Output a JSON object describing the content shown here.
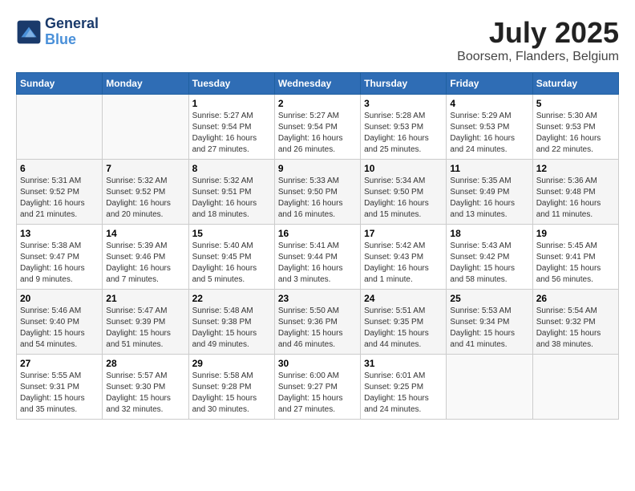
{
  "logo": {
    "text_general": "General",
    "text_blue": "Blue"
  },
  "title": "July 2025",
  "subtitle": "Boorsem, Flanders, Belgium",
  "days_of_week": [
    "Sunday",
    "Monday",
    "Tuesday",
    "Wednesday",
    "Thursday",
    "Friday",
    "Saturday"
  ],
  "weeks": [
    [
      {
        "day": "",
        "info": ""
      },
      {
        "day": "",
        "info": ""
      },
      {
        "day": "1",
        "info": "Sunrise: 5:27 AM\nSunset: 9:54 PM\nDaylight: 16 hours and 27 minutes."
      },
      {
        "day": "2",
        "info": "Sunrise: 5:27 AM\nSunset: 9:54 PM\nDaylight: 16 hours and 26 minutes."
      },
      {
        "day": "3",
        "info": "Sunrise: 5:28 AM\nSunset: 9:53 PM\nDaylight: 16 hours and 25 minutes."
      },
      {
        "day": "4",
        "info": "Sunrise: 5:29 AM\nSunset: 9:53 PM\nDaylight: 16 hours and 24 minutes."
      },
      {
        "day": "5",
        "info": "Sunrise: 5:30 AM\nSunset: 9:53 PM\nDaylight: 16 hours and 22 minutes."
      }
    ],
    [
      {
        "day": "6",
        "info": "Sunrise: 5:31 AM\nSunset: 9:52 PM\nDaylight: 16 hours and 21 minutes."
      },
      {
        "day": "7",
        "info": "Sunrise: 5:32 AM\nSunset: 9:52 PM\nDaylight: 16 hours and 20 minutes."
      },
      {
        "day": "8",
        "info": "Sunrise: 5:32 AM\nSunset: 9:51 PM\nDaylight: 16 hours and 18 minutes."
      },
      {
        "day": "9",
        "info": "Sunrise: 5:33 AM\nSunset: 9:50 PM\nDaylight: 16 hours and 16 minutes."
      },
      {
        "day": "10",
        "info": "Sunrise: 5:34 AM\nSunset: 9:50 PM\nDaylight: 16 hours and 15 minutes."
      },
      {
        "day": "11",
        "info": "Sunrise: 5:35 AM\nSunset: 9:49 PM\nDaylight: 16 hours and 13 minutes."
      },
      {
        "day": "12",
        "info": "Sunrise: 5:36 AM\nSunset: 9:48 PM\nDaylight: 16 hours and 11 minutes."
      }
    ],
    [
      {
        "day": "13",
        "info": "Sunrise: 5:38 AM\nSunset: 9:47 PM\nDaylight: 16 hours and 9 minutes."
      },
      {
        "day": "14",
        "info": "Sunrise: 5:39 AM\nSunset: 9:46 PM\nDaylight: 16 hours and 7 minutes."
      },
      {
        "day": "15",
        "info": "Sunrise: 5:40 AM\nSunset: 9:45 PM\nDaylight: 16 hours and 5 minutes."
      },
      {
        "day": "16",
        "info": "Sunrise: 5:41 AM\nSunset: 9:44 PM\nDaylight: 16 hours and 3 minutes."
      },
      {
        "day": "17",
        "info": "Sunrise: 5:42 AM\nSunset: 9:43 PM\nDaylight: 16 hours and 1 minute."
      },
      {
        "day": "18",
        "info": "Sunrise: 5:43 AM\nSunset: 9:42 PM\nDaylight: 15 hours and 58 minutes."
      },
      {
        "day": "19",
        "info": "Sunrise: 5:45 AM\nSunset: 9:41 PM\nDaylight: 15 hours and 56 minutes."
      }
    ],
    [
      {
        "day": "20",
        "info": "Sunrise: 5:46 AM\nSunset: 9:40 PM\nDaylight: 15 hours and 54 minutes."
      },
      {
        "day": "21",
        "info": "Sunrise: 5:47 AM\nSunset: 9:39 PM\nDaylight: 15 hours and 51 minutes."
      },
      {
        "day": "22",
        "info": "Sunrise: 5:48 AM\nSunset: 9:38 PM\nDaylight: 15 hours and 49 minutes."
      },
      {
        "day": "23",
        "info": "Sunrise: 5:50 AM\nSunset: 9:36 PM\nDaylight: 15 hours and 46 minutes."
      },
      {
        "day": "24",
        "info": "Sunrise: 5:51 AM\nSunset: 9:35 PM\nDaylight: 15 hours and 44 minutes."
      },
      {
        "day": "25",
        "info": "Sunrise: 5:53 AM\nSunset: 9:34 PM\nDaylight: 15 hours and 41 minutes."
      },
      {
        "day": "26",
        "info": "Sunrise: 5:54 AM\nSunset: 9:32 PM\nDaylight: 15 hours and 38 minutes."
      }
    ],
    [
      {
        "day": "27",
        "info": "Sunrise: 5:55 AM\nSunset: 9:31 PM\nDaylight: 15 hours and 35 minutes."
      },
      {
        "day": "28",
        "info": "Sunrise: 5:57 AM\nSunset: 9:30 PM\nDaylight: 15 hours and 32 minutes."
      },
      {
        "day": "29",
        "info": "Sunrise: 5:58 AM\nSunset: 9:28 PM\nDaylight: 15 hours and 30 minutes."
      },
      {
        "day": "30",
        "info": "Sunrise: 6:00 AM\nSunset: 9:27 PM\nDaylight: 15 hours and 27 minutes."
      },
      {
        "day": "31",
        "info": "Sunrise: 6:01 AM\nSunset: 9:25 PM\nDaylight: 15 hours and 24 minutes."
      },
      {
        "day": "",
        "info": ""
      },
      {
        "day": "",
        "info": ""
      }
    ]
  ]
}
